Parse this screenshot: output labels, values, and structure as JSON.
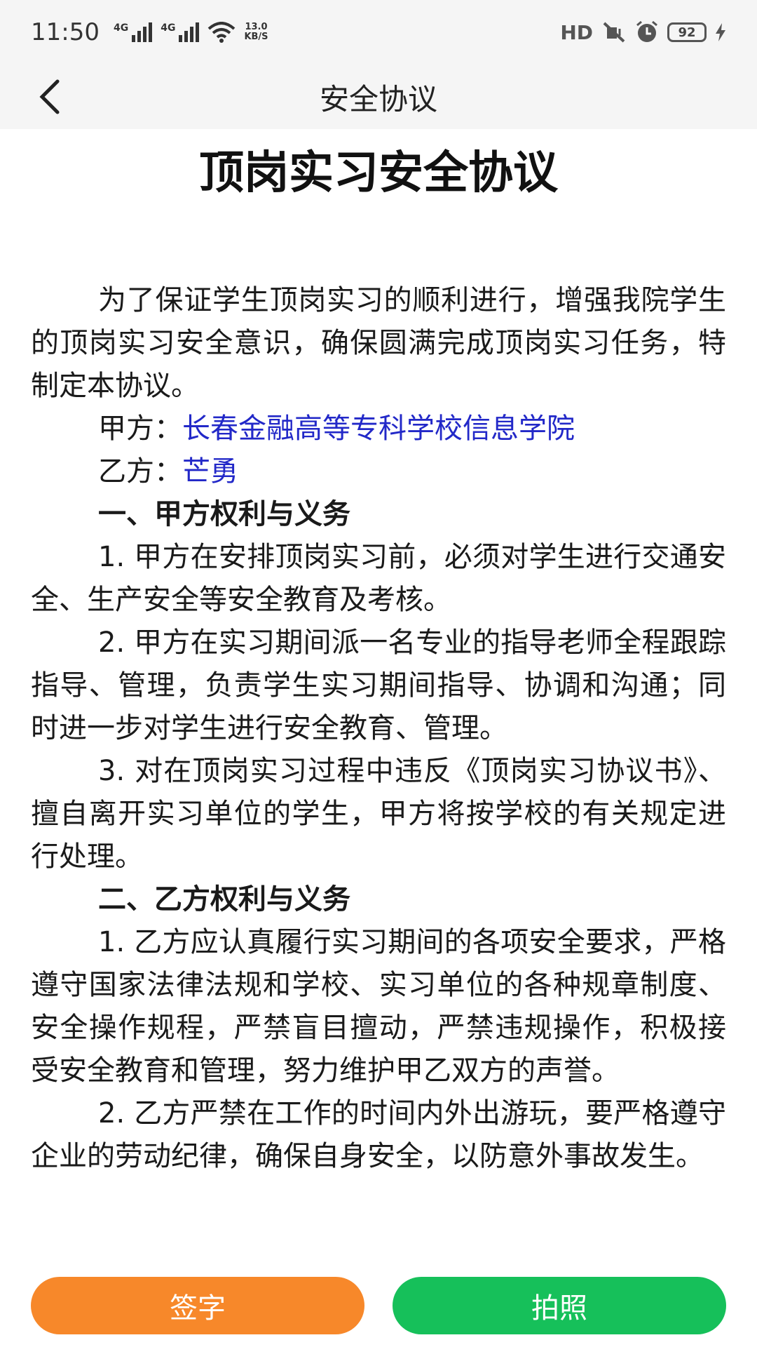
{
  "status_bar": {
    "time": "11:50",
    "signal1_label": "4G",
    "signal2_label": "4G",
    "net_speed_value": "13.0",
    "net_speed_unit": "KB/S",
    "hd_label": "HD",
    "battery_level": "92"
  },
  "nav": {
    "title": "安全协议"
  },
  "document": {
    "title": "顶岗实习安全协议",
    "intro": "为了保证学生顶岗实习的顺利进行，增强我院学生的顶岗实习安全意识，确保圆满完成顶岗实习任务，特制定本协议。",
    "party_a_label": "甲方：",
    "party_a_value": "长春金融高等专科学校信息学院",
    "party_b_label": "乙方：",
    "party_b_value": "芒勇",
    "section1_heading": "一、甲方权利与义务",
    "s1_item1": "1. 甲方在安排顶岗实习前，必须对学生进行交通安全、生产安全等安全教育及考核。",
    "s1_item2": "2. 甲方在实习期间派一名专业的指导老师全程跟踪指导、管理，负责学生实习期间指导、协调和沟通；同时进一步对学生进行安全教育、管理。",
    "s1_item3": "3. 对在顶岗实习过程中违反《顶岗实习协议书》、擅自离开实习单位的学生，甲方将按学校的有关规定进行处理。",
    "section2_heading": "二、乙方权利与义务",
    "s2_item1": "1. 乙方应认真履行实习期间的各项安全要求，严格遵守国家法律法规和学校、实习单位的各种规章制度、安全操作规程，严禁盲目擅动，严禁违规操作，积极接受安全教育和管理，努力维护甲乙双方的声誉。",
    "s2_item2": "2. 乙方严禁在工作的时间内外出游玩，要严格遵守企业的劳动纪律，确保自身安全，以防意外事故发生。"
  },
  "buttons": {
    "sign_label": "签字",
    "photo_label": "拍照"
  },
  "colors": {
    "sign_button": "#f7882a",
    "photo_button": "#16c05a",
    "party_value_text": "#2228c8",
    "bar_background": "#f5f5f5"
  }
}
